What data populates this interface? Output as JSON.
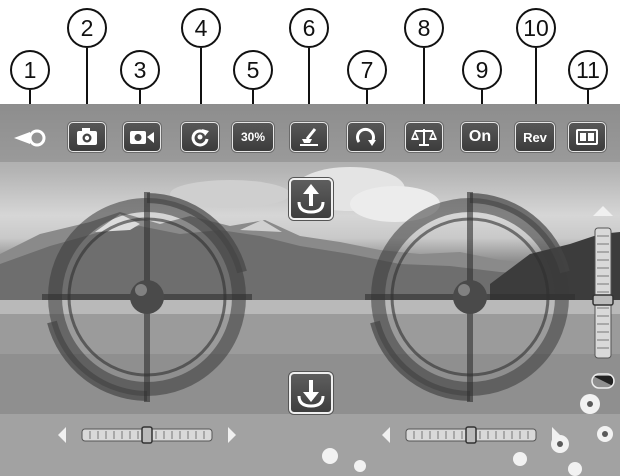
{
  "callouts": [
    "1",
    "2",
    "3",
    "4",
    "5",
    "6",
    "7",
    "8",
    "9",
    "10",
    "11"
  ],
  "toolbar": {
    "speed_label": "30%",
    "headless_label": "On",
    "reverse_label": "Rev",
    "icons": [
      "back-icon",
      "camera-icon",
      "video-icon",
      "rotate-icon",
      "speed-label",
      "gyro-calibrate-icon",
      "flip-icon",
      "balance-icon",
      "headless-label",
      "reverse-label",
      "split-screen-icon"
    ]
  },
  "controls": {
    "icons": [
      "takeoff-arrow-up-icon",
      "land-arrow-down-icon",
      "left-joystick",
      "right-joystick",
      "left-trim-slider",
      "right-trim-slider",
      "vertical-trim-slider"
    ]
  },
  "colors": {
    "button_dark": "#4a4a4a",
    "button_border": "#e6e6e6",
    "callout_line": "#111111"
  }
}
